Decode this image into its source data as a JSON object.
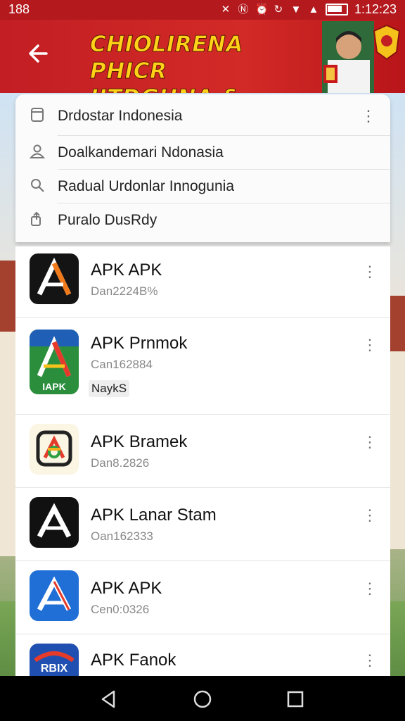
{
  "status_bar": {
    "left_text": "188",
    "time": "1:12:23"
  },
  "banner": {
    "headline_line1": "CHIOLIRENA PHICR",
    "headline_line2": "IITDGHNA & NONS!"
  },
  "menu": {
    "items": [
      {
        "icon": "file-icon",
        "label": "Drdostar Indonesia"
      },
      {
        "icon": "person-icon",
        "label": "Doalkandemari Ndonasia"
      },
      {
        "icon": "search-icon",
        "label": "Radual Urdonlar Innogunia"
      },
      {
        "icon": "share-icon",
        "label": "Puralo DusRdy"
      }
    ]
  },
  "apps": [
    {
      "name": "APK APK",
      "sub": "Dan2224B%",
      "tag": null
    },
    {
      "name": "APK Prnmok",
      "sub": "Can162884",
      "tag": "NaykS"
    },
    {
      "name": "APK Bramek",
      "sub": "Dan8.2826",
      "tag": null
    },
    {
      "name": "APK Lanar Stam",
      "sub": "Oan162333",
      "tag": null
    },
    {
      "name": "APK APK",
      "sub": "Cen0:0326",
      "tag": null
    },
    {
      "name": "APK Fanok",
      "sub": "",
      "tag": null
    }
  ],
  "app_icon_text": {
    "apk_badge": "IAPK",
    "fanok_badge": "RBIX"
  },
  "colors": {
    "status_bar": "#b3191d",
    "banner": "#c21e24",
    "headline": "#ffd21a"
  }
}
